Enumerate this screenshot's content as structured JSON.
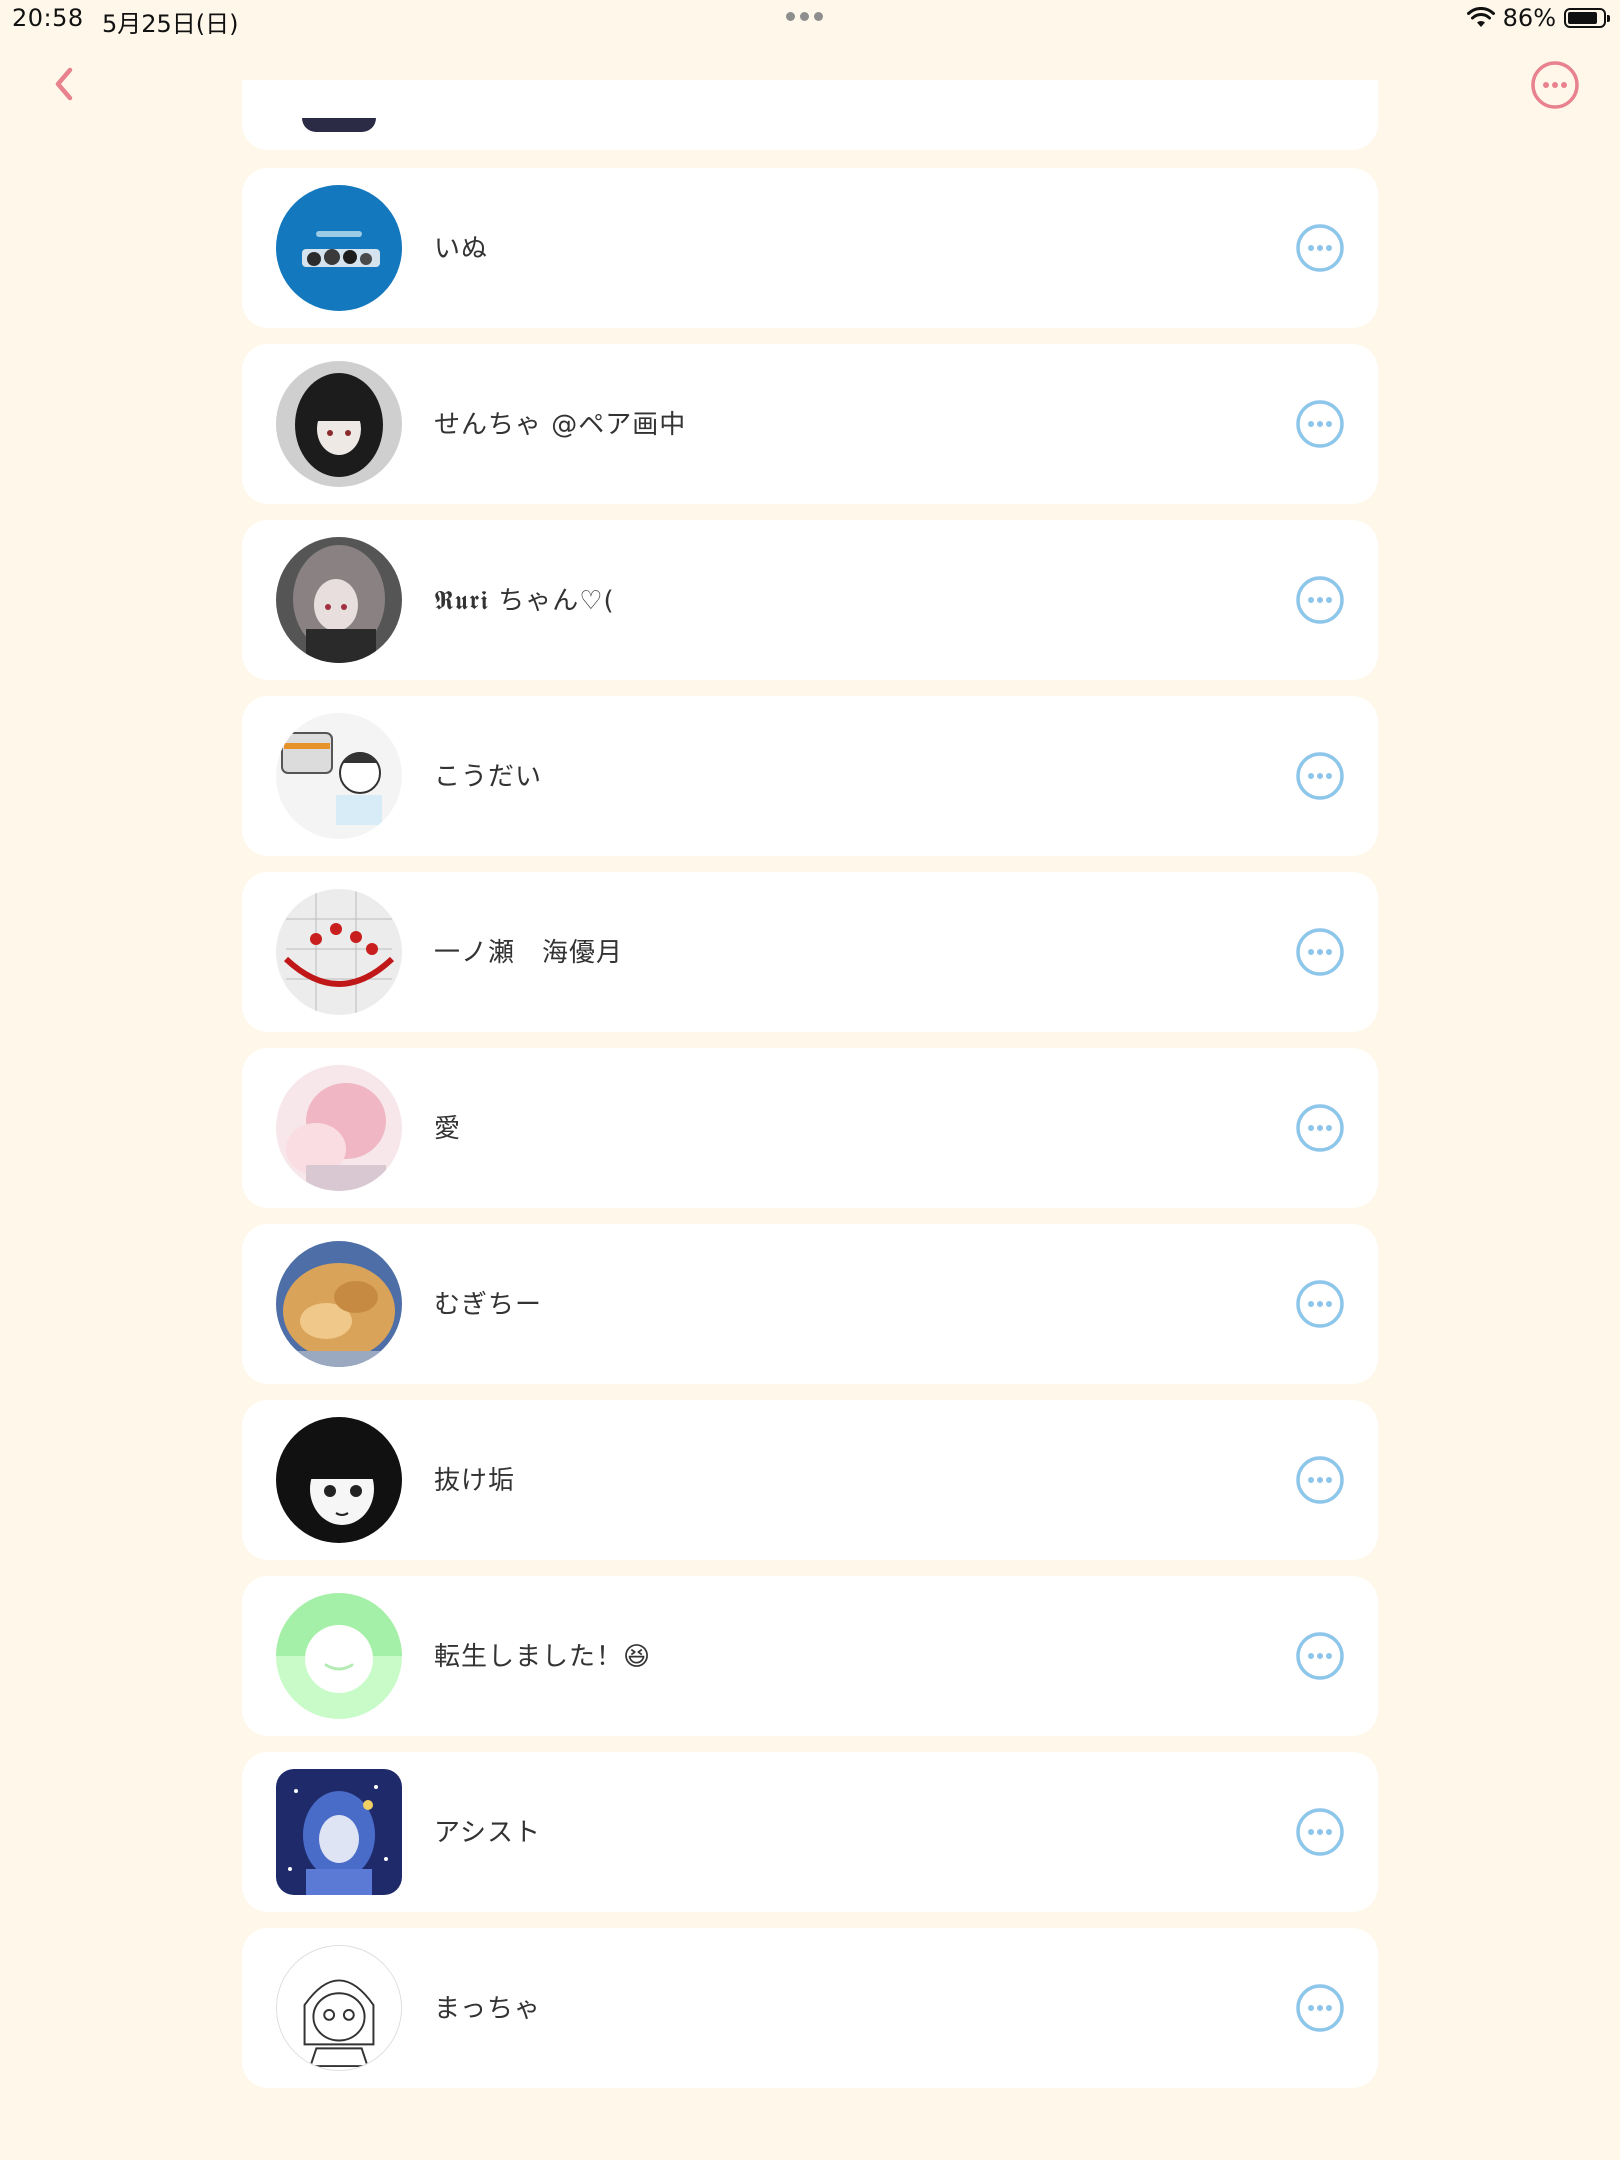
{
  "status_bar": {
    "time": "20:58",
    "date": "5月25日(日)",
    "battery": "86%",
    "battery_level": 0.86
  },
  "header": {
    "back_icon": "chevron-left-icon",
    "more_icon": "ellipsis-circle-icon",
    "accent_color": "#E8828F"
  },
  "list": {
    "item_more_icon": "ellipsis-circle-icon",
    "item_more_color": "#8DC6EA",
    "items": [
      {
        "name": "いぬ"
      },
      {
        "name": "せんちゃ @ペア画中"
      },
      {
        "name": "𝕽𝖚𝖗𝖎 ちゃん♡("
      },
      {
        "name": "こうだい"
      },
      {
        "name": "一ノ瀬　海優月"
      },
      {
        "name": "愛"
      },
      {
        "name": "むぎちー"
      },
      {
        "name": "抜け垢"
      },
      {
        "name": "転生しました！😆"
      },
      {
        "name": "アシスト"
      },
      {
        "name": "まっちゃ"
      }
    ]
  }
}
